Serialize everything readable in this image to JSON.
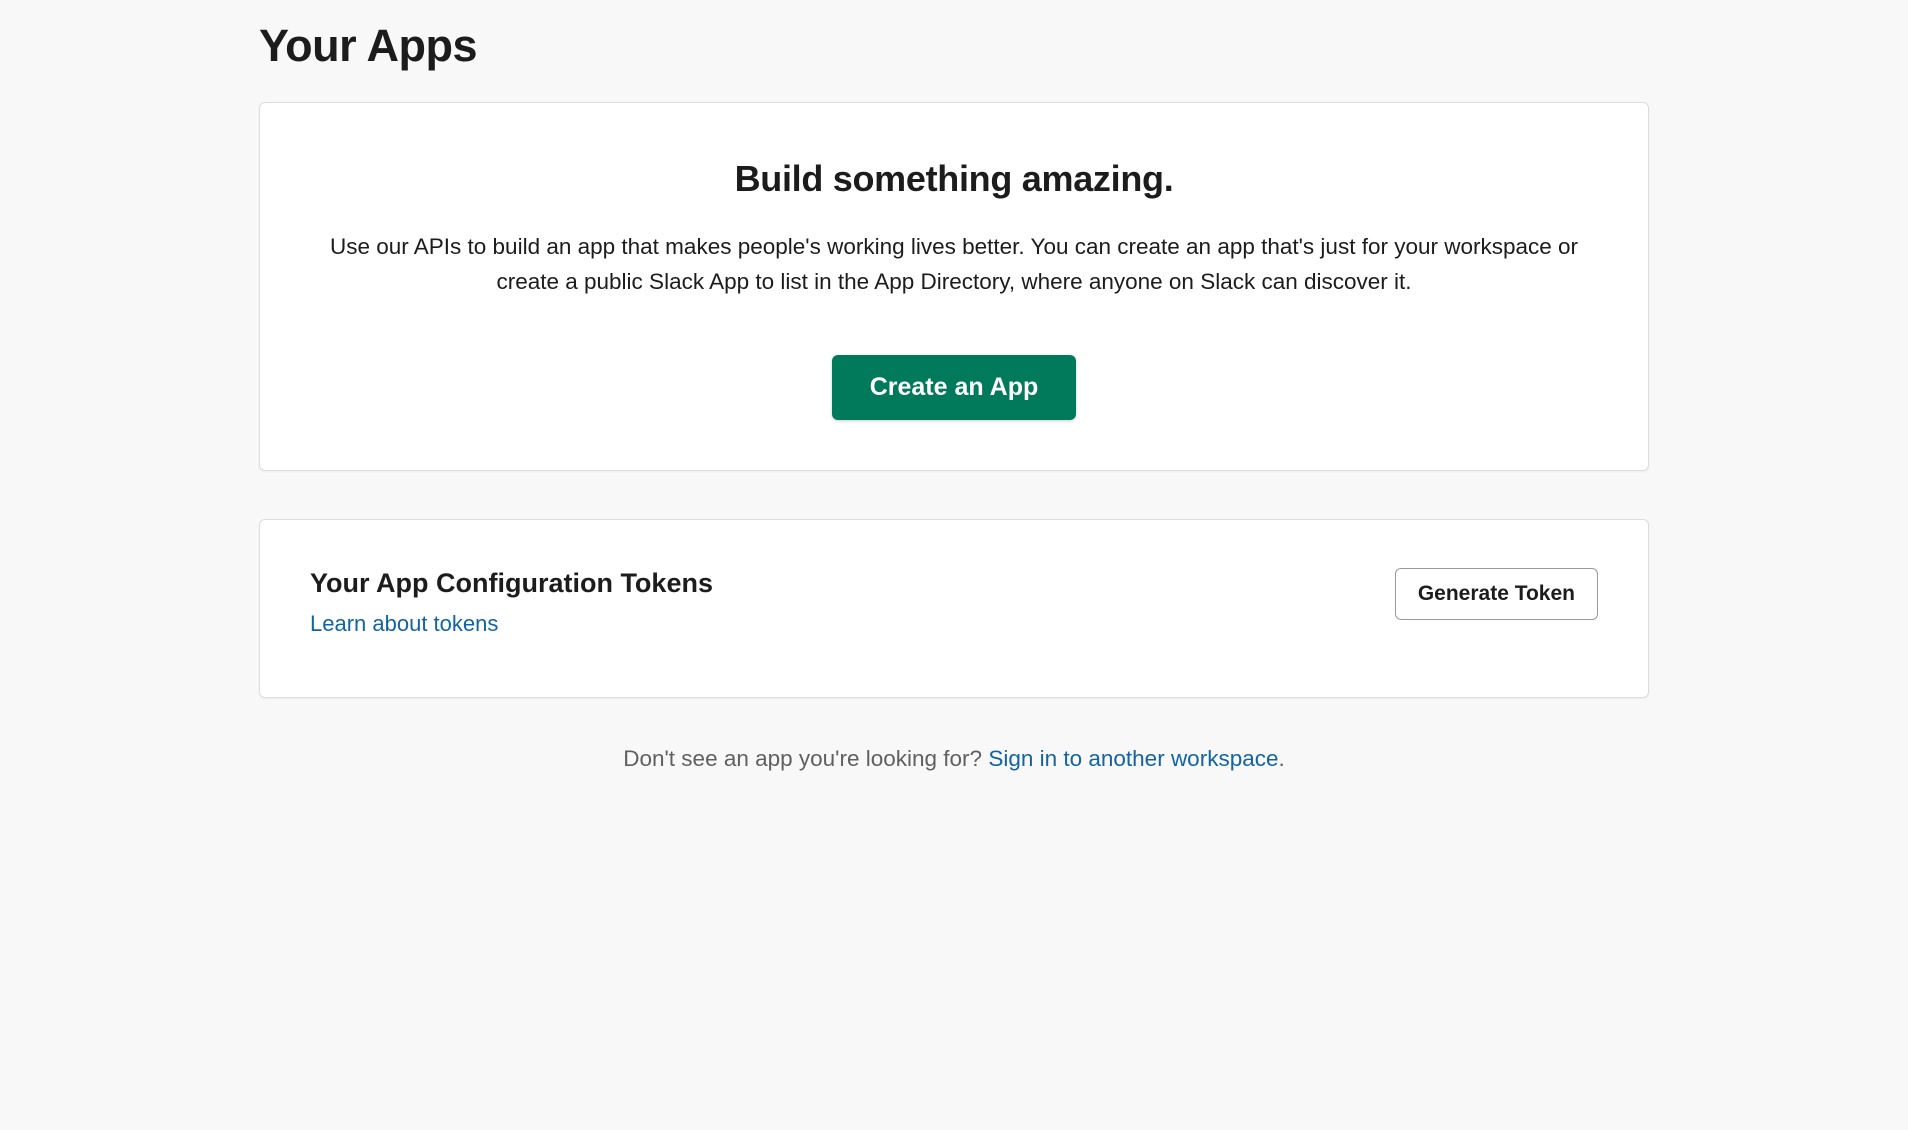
{
  "page": {
    "title": "Your Apps"
  },
  "hero": {
    "title": "Build something amazing.",
    "description": "Use our APIs to build an app that makes people's working lives better. You can create an app that's just for your workspace or create a public Slack App to list in the App Directory, where anyone on Slack can discover it.",
    "create_button_label": "Create an App"
  },
  "tokens": {
    "title": "Your App Configuration Tokens",
    "learn_link_label": "Learn about tokens",
    "generate_button_label": "Generate Token"
  },
  "footer": {
    "prompt_text": "Don't see an app you're looking for? ",
    "signin_link_label": "Sign in to another workspace",
    "period": "."
  }
}
